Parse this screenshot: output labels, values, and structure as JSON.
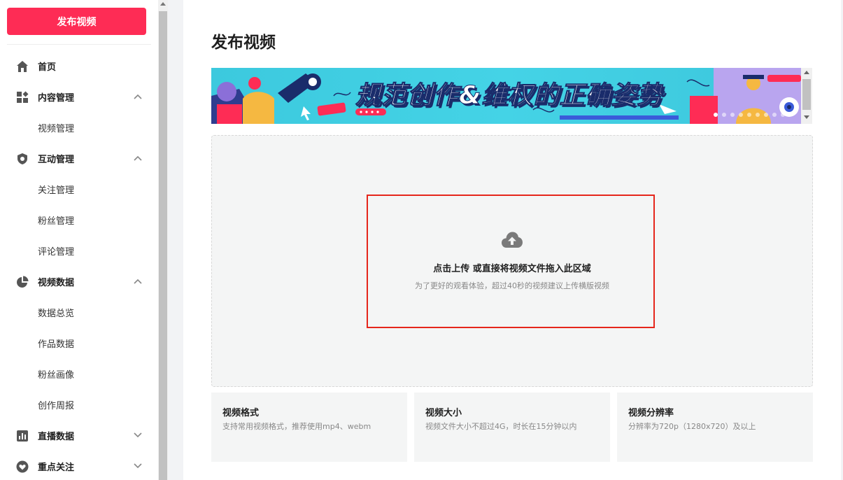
{
  "sidebar": {
    "publish_label": "发布视频",
    "items": [
      {
        "label": "首页",
        "icon": "home-icon",
        "type": "top"
      },
      {
        "label": "内容管理",
        "icon": "content-grid-icon",
        "type": "group",
        "chevron": "up"
      },
      {
        "label": "视频管理",
        "type": "sub"
      },
      {
        "label": "互动管理",
        "icon": "interaction-icon",
        "type": "group",
        "chevron": "up"
      },
      {
        "label": "关注管理",
        "type": "sub"
      },
      {
        "label": "粉丝管理",
        "type": "sub"
      },
      {
        "label": "评论管理",
        "type": "sub"
      },
      {
        "label": "视频数据",
        "icon": "pie-chart-icon",
        "type": "group",
        "chevron": "up"
      },
      {
        "label": "数据总览",
        "type": "sub"
      },
      {
        "label": "作品数据",
        "type": "sub"
      },
      {
        "label": "粉丝画像",
        "type": "sub"
      },
      {
        "label": "创作周报",
        "type": "sub"
      },
      {
        "label": "直播数据",
        "icon": "bar-chart-icon",
        "type": "group",
        "chevron": "down"
      },
      {
        "label": "重点关注",
        "icon": "heart-icon",
        "type": "group",
        "chevron": "down"
      }
    ]
  },
  "main": {
    "title": "发布视频",
    "banner": {
      "text": "规范创作&维权的正确姿势",
      "dot_count": 9,
      "active_dot": 0
    },
    "upload": {
      "main_text": "点击上传 或直接将视频文件拖入此区域",
      "sub_text": "为了更好的观看体验，超过40秒的视频建议上传横版视频",
      "icon": "cloud-upload-icon"
    },
    "cards": [
      {
        "title": "视频格式",
        "desc": "支持常用视频格式，推荐使用mp4、webm"
      },
      {
        "title": "视频大小",
        "desc": "视频文件大小不超过4G，时长在15分钟以内"
      },
      {
        "title": "视频分辨率",
        "desc": "分辨率为720p（1280x720）及以上"
      }
    ]
  },
  "colors": {
    "brand": "#fe2c55",
    "highlight": "#e5261b",
    "banner": "#44d3e6"
  }
}
